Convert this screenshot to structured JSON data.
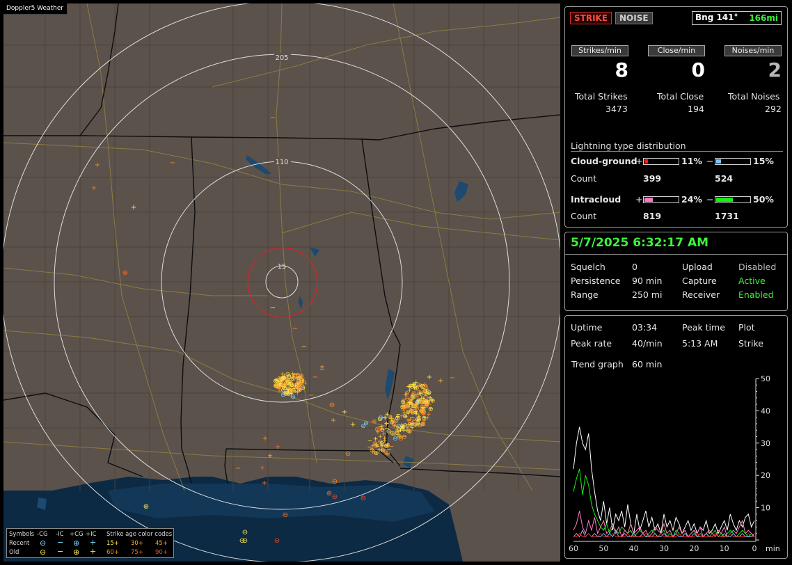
{
  "app": {
    "title": "Doppler5 Weather"
  },
  "mode_buttons": {
    "strike": "STRIKE",
    "noise": "NOISE"
  },
  "bearing": {
    "deg": "Bng 141°",
    "dist": "166mi"
  },
  "rates": {
    "strikes_label": "Strikes/min",
    "strikes_value": "8",
    "close_label": "Close/min",
    "close_value": "0",
    "noises_label": "Noises/min",
    "noises_value": "2"
  },
  "totals": {
    "strikes_label": "Total Strikes",
    "strikes_value": "3473",
    "close_label": "Total Close",
    "close_value": "194",
    "noises_label": "Total Noises",
    "noises_value": "292"
  },
  "distribution": {
    "title": "Lightning type distribution",
    "cg_label": "Cloud-ground",
    "ic_label": "Intracloud",
    "count_label": "Count",
    "plus": "+",
    "minus": "−",
    "cg_pos_pct": "11%",
    "cg_neg_pct": "15%",
    "cg_pos_count": "399",
    "cg_neg_count": "524",
    "ic_pos_pct": "24%",
    "ic_neg_pct": "50%",
    "ic_pos_count": "819",
    "ic_neg_count": "1731",
    "cg_pos_frac": 0.11,
    "cg_neg_frac": 0.15,
    "ic_pos_frac": 0.24,
    "ic_neg_frac": 0.5,
    "colors": {
      "cg_pos": "#ff1a1a",
      "cg_neg": "#7fc4ff",
      "ic_pos": "#ff7ac0",
      "ic_neg": "#19ee19"
    }
  },
  "status": {
    "datetime": "5/7/2025 6:32:17 AM",
    "squelch_label": "Squelch",
    "squelch_value": "0",
    "persistence_label": "Persistence",
    "persistence_value": "90 min",
    "range_label": "Range",
    "range_value": "250 mi",
    "upload_label": "Upload",
    "upload_value": "Disabled",
    "capture_label": "Capture",
    "capture_value": "Active",
    "receiver_label": "Receiver",
    "receiver_value": "Enabled"
  },
  "stats": {
    "uptime_label": "Uptime",
    "uptime_value": "03:34",
    "peak_time_label": "Peak time",
    "peak_time_value": "5:13 AM",
    "plot_label": "Plot",
    "plot_value": "Strike",
    "peak_rate_label": "Peak rate",
    "peak_rate_value": "40/min",
    "trend_label": "Trend graph",
    "trend_value": "60 min"
  },
  "chart_data": {
    "type": "line",
    "x_ticks": [
      "60",
      "50",
      "40",
      "30",
      "20",
      "10",
      "0"
    ],
    "x_unit": "min",
    "y_ticks": [
      "50",
      "40",
      "30",
      "20",
      "10"
    ],
    "ylim": [
      0,
      50
    ],
    "xlim": [
      60,
      0
    ],
    "series": [
      {
        "color": "#ffffff",
        "values": [
          22,
          30,
          35,
          30,
          28,
          33,
          22,
          15,
          9,
          6,
          12,
          5,
          10,
          3,
          8,
          6,
          9,
          4,
          11,
          5,
          2,
          8,
          3,
          6,
          9,
          4,
          7,
          3,
          5,
          2,
          8,
          4,
          6,
          3,
          7,
          5,
          2,
          4,
          6,
          3,
          5,
          2,
          4,
          3,
          6,
          2,
          3,
          5,
          2,
          4,
          6,
          3,
          8,
          5,
          3,
          6,
          4,
          7,
          8,
          4,
          6
        ]
      },
      {
        "color": "#19ee19",
        "values": [
          15,
          19,
          22,
          14,
          20,
          17,
          11,
          8,
          6,
          4,
          3,
          5,
          2,
          4,
          3,
          2,
          4,
          3,
          2,
          3,
          1,
          2,
          3,
          2,
          1,
          2,
          3,
          2,
          1,
          2,
          3,
          1,
          2,
          1,
          3,
          2,
          1,
          2,
          1,
          2,
          3,
          1,
          2,
          1,
          2,
          1,
          2,
          3,
          1,
          2,
          1,
          2,
          3,
          2,
          1,
          2,
          3,
          2,
          1,
          2,
          1
        ]
      },
      {
        "color": "#ff7ac0",
        "values": [
          3,
          5,
          9,
          4,
          2,
          6,
          3,
          7,
          2,
          4,
          6,
          2,
          3,
          5,
          2,
          4,
          1,
          3,
          2,
          5,
          2,
          3,
          4,
          2,
          3,
          1,
          2,
          4,
          3,
          2,
          5,
          2,
          3,
          1,
          2,
          4,
          2,
          3,
          1,
          2,
          3,
          2,
          4,
          1,
          2,
          3,
          2,
          1,
          3,
          2,
          4,
          1,
          2,
          3,
          2,
          4,
          6,
          2,
          3,
          2,
          1
        ]
      },
      {
        "color": "#7fc4ff",
        "values": [
          1,
          2,
          1,
          3,
          1,
          2,
          1,
          2,
          1,
          1,
          2,
          1,
          2,
          1,
          3,
          1,
          1,
          2,
          1,
          1,
          2,
          1,
          1,
          2,
          1,
          1,
          1,
          2,
          1,
          1,
          2,
          1,
          1,
          1,
          2,
          1,
          1,
          2,
          1,
          1,
          2,
          1,
          1,
          1,
          2,
          1,
          1,
          2,
          1,
          1,
          2,
          1,
          1,
          2,
          1,
          1,
          2,
          1,
          1,
          1,
          2
        ]
      },
      {
        "color": "#ff1a1a",
        "values": [
          1,
          1,
          2,
          1,
          1,
          2,
          1,
          1,
          1,
          2,
          1,
          1,
          1,
          2,
          1,
          1,
          1,
          1,
          2,
          1,
          1,
          1,
          1,
          1,
          2,
          1,
          1,
          1,
          1,
          2,
          1,
          1,
          1,
          1,
          1,
          2,
          1,
          1,
          1,
          1,
          1,
          2,
          1,
          1,
          1,
          1,
          1,
          2,
          1,
          1,
          1,
          1,
          2,
          1,
          1,
          1,
          1,
          1,
          2,
          1,
          1
        ]
      }
    ]
  },
  "map": {
    "range_rings": [
      "205",
      "110",
      "15"
    ],
    "colors": {
      "land": "#5b524c",
      "water": "#1c4a70",
      "gulf": "#0c2a44",
      "borders": "#111111",
      "roads": "#9b8a3e"
    }
  },
  "legend": {
    "symbols_label": "Symbols",
    "cg_neg": "-CG",
    "ic_neg": "-IC",
    "cg_pos": "+CG",
    "ic_pos": "+IC",
    "recent_label": "Recent",
    "old_label": "Old",
    "age_title": "Strike age color codes",
    "recent_ages": [
      "15+",
      "30+",
      "45+"
    ],
    "old_ages": [
      "60+",
      "75+",
      "90+"
    ]
  }
}
